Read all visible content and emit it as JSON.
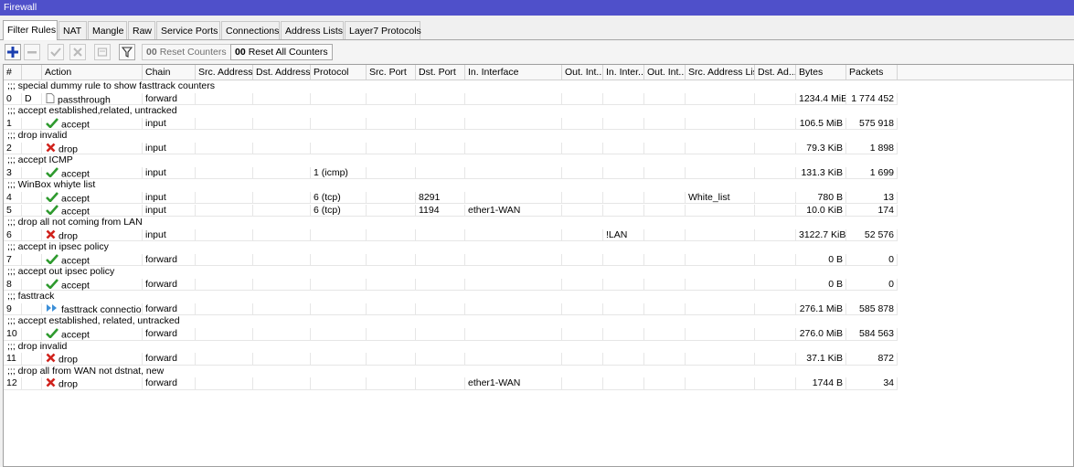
{
  "window": {
    "title": "Firewall"
  },
  "tabs": [
    {
      "label": "Filter Rules",
      "active": true
    },
    {
      "label": "NAT"
    },
    {
      "label": "Mangle"
    },
    {
      "label": "Raw"
    },
    {
      "label": "Service Ports"
    },
    {
      "label": "Connections"
    },
    {
      "label": "Address Lists"
    },
    {
      "label": "Layer7 Protocols"
    }
  ],
  "toolbar": {
    "add_icon": "plus-icon",
    "remove_icon": "minus-icon",
    "enable_icon": "check-icon",
    "disable_icon": "cross-icon",
    "comment_icon": "note-icon",
    "filter_icon": "filter-icon",
    "reset_counters_prefix": "00",
    "reset_counters_label": "Reset Counters",
    "reset_all_prefix": "00",
    "reset_all_label": "Reset All Counters"
  },
  "columns": [
    "#",
    "Action",
    "Chain",
    "Src. Address",
    "Dst. Address",
    "Protocol",
    "Src. Port",
    "Dst. Port",
    "In. Interface",
    "Out. Int...",
    "In. Inter...",
    "Out. Int...",
    "Src. Address List",
    "Dst. Ad...",
    "Bytes",
    "Packets"
  ],
  "colors": {
    "title_bar": "#4f50ca",
    "accept": "#2e9a2e",
    "drop": "#d0221c",
    "fasttrack": "#3c8fd8"
  },
  "rows": [
    {
      "type": "comment",
      "text": ";;; special dummy rule to show fasttrack counters"
    },
    {
      "type": "rule",
      "num": "0",
      "flag": "D",
      "action": "passthrough",
      "icon": "passthrough-icon",
      "chain": "forward",
      "protocol": "",
      "dst_port": "",
      "in_interface": "",
      "in_interface_list": "",
      "src_address_list": "",
      "bytes": "1234.4 MiB",
      "packets": "1 774 452"
    },
    {
      "type": "comment",
      "text": ";;; accept established,related, untracked"
    },
    {
      "type": "rule",
      "num": "1",
      "flag": "",
      "action": "accept",
      "icon": "accept-icon",
      "chain": "input",
      "protocol": "",
      "dst_port": "",
      "in_interface": "",
      "in_interface_list": "",
      "src_address_list": "",
      "bytes": "106.5 MiB",
      "packets": "575 918"
    },
    {
      "type": "comment",
      "text": ";;; drop invalid"
    },
    {
      "type": "rule",
      "num": "2",
      "flag": "",
      "action": "drop",
      "icon": "drop-icon",
      "chain": "input",
      "protocol": "",
      "dst_port": "",
      "in_interface": "",
      "in_interface_list": "",
      "src_address_list": "",
      "bytes": "79.3 KiB",
      "packets": "1 898"
    },
    {
      "type": "comment",
      "text": ";;; accept ICMP"
    },
    {
      "type": "rule",
      "num": "3",
      "flag": "",
      "action": "accept",
      "icon": "accept-icon",
      "chain": "input",
      "protocol": "1 (icmp)",
      "dst_port": "",
      "in_interface": "",
      "in_interface_list": "",
      "src_address_list": "",
      "bytes": "131.3 KiB",
      "packets": "1 699"
    },
    {
      "type": "comment",
      "text": ";;; WinBox whiyte list"
    },
    {
      "type": "rule",
      "num": "4",
      "flag": "",
      "action": "accept",
      "icon": "accept-icon",
      "chain": "input",
      "protocol": "6 (tcp)",
      "dst_port": "8291",
      "in_interface": "",
      "in_interface_list": "",
      "src_address_list": "White_list",
      "bytes": "780 B",
      "packets": "13"
    },
    {
      "type": "rule",
      "num": "5",
      "flag": "",
      "action": "accept",
      "icon": "accept-icon",
      "chain": "input",
      "protocol": "6 (tcp)",
      "dst_port": "1194",
      "in_interface": "ether1-WAN",
      "in_interface_list": "",
      "src_address_list": "",
      "bytes": "10.0 KiB",
      "packets": "174"
    },
    {
      "type": "comment",
      "text": ";;; drop all not coming from LAN"
    },
    {
      "type": "rule",
      "num": "6",
      "flag": "",
      "action": "drop",
      "icon": "drop-icon",
      "chain": "input",
      "protocol": "",
      "dst_port": "",
      "in_interface": "",
      "in_interface_list": "!LAN",
      "src_address_list": "",
      "bytes": "3122.7 KiB",
      "packets": "52 576"
    },
    {
      "type": "comment",
      "text": ";;; accept in ipsec policy"
    },
    {
      "type": "rule",
      "num": "7",
      "flag": "",
      "action": "accept",
      "icon": "accept-icon",
      "chain": "forward",
      "protocol": "",
      "dst_port": "",
      "in_interface": "",
      "in_interface_list": "",
      "src_address_list": "",
      "bytes": "0 B",
      "packets": "0"
    },
    {
      "type": "comment",
      "text": ";;; accept out ipsec policy"
    },
    {
      "type": "rule",
      "num": "8",
      "flag": "",
      "action": "accept",
      "icon": "accept-icon",
      "chain": "forward",
      "protocol": "",
      "dst_port": "",
      "in_interface": "",
      "in_interface_list": "",
      "src_address_list": "",
      "bytes": "0 B",
      "packets": "0"
    },
    {
      "type": "comment",
      "text": ";;;  fasttrack"
    },
    {
      "type": "rule",
      "num": "9",
      "flag": "",
      "action": "fasttrack connection",
      "icon": "fasttrack-icon",
      "chain": "forward",
      "protocol": "",
      "dst_port": "",
      "in_interface": "",
      "in_interface_list": "",
      "src_address_list": "",
      "bytes": "276.1 MiB",
      "packets": "585 878"
    },
    {
      "type": "comment",
      "text": ";;; accept established, related, untracked"
    },
    {
      "type": "rule",
      "num": "10",
      "flag": "",
      "action": "accept",
      "icon": "accept-icon",
      "chain": "forward",
      "protocol": "",
      "dst_port": "",
      "in_interface": "",
      "in_interface_list": "",
      "src_address_list": "",
      "bytes": "276.0 MiB",
      "packets": "584 563"
    },
    {
      "type": "comment",
      "text": ";;; drop invalid"
    },
    {
      "type": "rule",
      "num": "11",
      "flag": "",
      "action": "drop",
      "icon": "drop-icon",
      "chain": "forward",
      "protocol": "",
      "dst_port": "",
      "in_interface": "",
      "in_interface_list": "",
      "src_address_list": "",
      "bytes": "37.1 KiB",
      "packets": "872"
    },
    {
      "type": "comment",
      "text": ";;; drop all from WAN not dstnat, new"
    },
    {
      "type": "rule",
      "num": "12",
      "flag": "",
      "action": "drop",
      "icon": "drop-icon",
      "chain": "forward",
      "protocol": "",
      "dst_port": "",
      "in_interface": "ether1-WAN",
      "in_interface_list": "",
      "src_address_list": "",
      "bytes": "1744 B",
      "packets": "34"
    }
  ]
}
